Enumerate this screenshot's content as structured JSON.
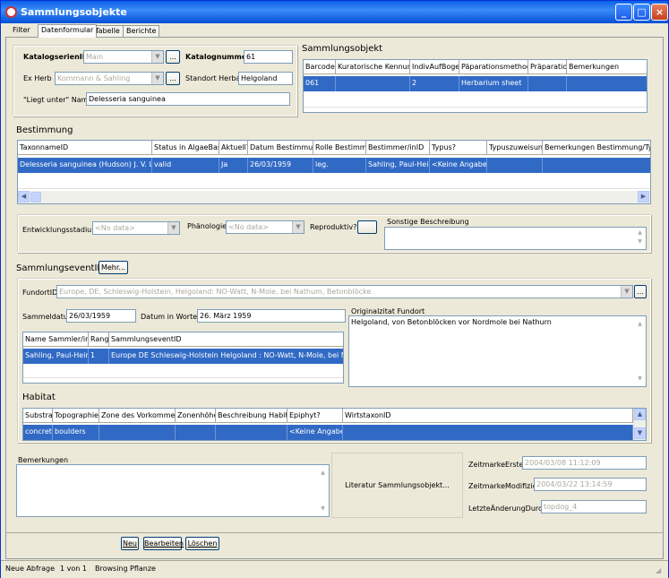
{
  "window": {
    "title": "Sammlungsobjekte"
  },
  "tabs": [
    "Filter",
    "Datenformular",
    "Tabelle",
    "Berichte"
  ],
  "header": {
    "katalogserien_label": "KatalogserienID",
    "katalogserien_value": "Main",
    "katalognummer_label": "Katalognummer",
    "katalognummer_value": "61",
    "exherb_label": "Ex Herb",
    "exherb_value": "Kommann & Sahling",
    "standort_label": "Standort Herbar",
    "standort_value": "Helgoland",
    "liegt_label": "\"Liegt unter\" Name",
    "liegt_value": "Delesseria sanguinea",
    "dots": "..."
  },
  "sammlungsobjekt": {
    "title": "Sammlungsobjekt",
    "columns": [
      "Barcode",
      "Kuratorische Kennung",
      "IndivAufBogen",
      "Päparationsmethode",
      "Präparation",
      "Bemerkungen"
    ],
    "rows": [
      [
        "061",
        "",
        "2",
        "Herbarium sheet",
        "",
        ""
      ]
    ]
  },
  "bestimmung": {
    "title": "Bestimmung",
    "columns": [
      "TaxonnameID",
      "Status in AlgaeBase",
      "Aktuell?",
      "Datum Bestimmung",
      "Rolle Bestimmer",
      "Bestimmer/inID",
      "Typus?",
      "Typuszuweisung",
      "Bemerkungen Bestimmung/Typus"
    ],
    "rows": [
      [
        "Delesseria sanguinea (Hudson) J. V. Lamo",
        "valid",
        "Ja",
        "26/03/1959",
        "leg.",
        "Sahling, Paul-Heinz",
        "<Keine Angabe>",
        "",
        ""
      ]
    ]
  },
  "stadium": {
    "entwicklung_label": "Entwicklungsstadium",
    "entwicklung_value": "<No data>",
    "phaenologie_label": "Phänologie",
    "phaenologie_value": "<No data>",
    "reproduktiv_label": "Reproduktiv?",
    "sonstige_label": "Sonstige Beschreibung"
  },
  "event": {
    "title": "SammlungseventID",
    "mehr": "Mehr...",
    "fundort_label": "FundortID",
    "fundort_value": "Europe, DE, Schleswig-Holstein, Helgoland: NO-Watt, N-Mole, bei Nathum, Betonblöcke",
    "sammeldatum_label": "Sammeldatum",
    "sammeldatum_value": "26/03/1959",
    "datumworte_label": "Datum in Worten",
    "datumworte_value": "26. März 1959",
    "original_label": "Originalzitat Fundort",
    "original_value": "Helgoland, von Betonblöcken vor Nordmole bei Nathurn",
    "sammler_columns": [
      "Name Sammler/in",
      "Rang",
      "SammlungseventID"
    ],
    "sammler_rows": [
      [
        "Sahling, Paul-Heinz",
        "1",
        "Europe DE Schleswig-Holstein Helgoland : NO-Watt, N-Mole, bei Nathum,"
      ]
    ]
  },
  "habitat": {
    "title": "Habitat",
    "columns": [
      "Substrat",
      "Topographie",
      "Zone des Vorkommens",
      "Zonenhöhe",
      "Beschreibung Habitat",
      "Epiphyt?",
      "WirtstaxonID"
    ],
    "rows": [
      [
        "concrete",
        "boulders",
        "",
        "",
        "",
        "<Keine Angabe>",
        ""
      ]
    ]
  },
  "bottom": {
    "bemerkungen_label": "Bemerkungen",
    "literatur_button": "Literatur Sammlungsobjekt...",
    "erstellt_label": "ZeitmarkeErstellt",
    "erstellt_value": "2004/03/08 11:12:09",
    "modifiziert_label": "ZeitmarkeModifiziert",
    "modifiziert_value": "2004/03/22 13:14:59",
    "letzte_label": "LetzteÄnderungDurch",
    "letzte_value": "topdog_4"
  },
  "actions": {
    "neu": "Neu",
    "bearbeiten": "Bearbeiten",
    "loeschen": "Löschen"
  },
  "statusbar": [
    "Neue Abfrage",
    "1 von 1",
    "Browsing",
    "Pflanze"
  ]
}
